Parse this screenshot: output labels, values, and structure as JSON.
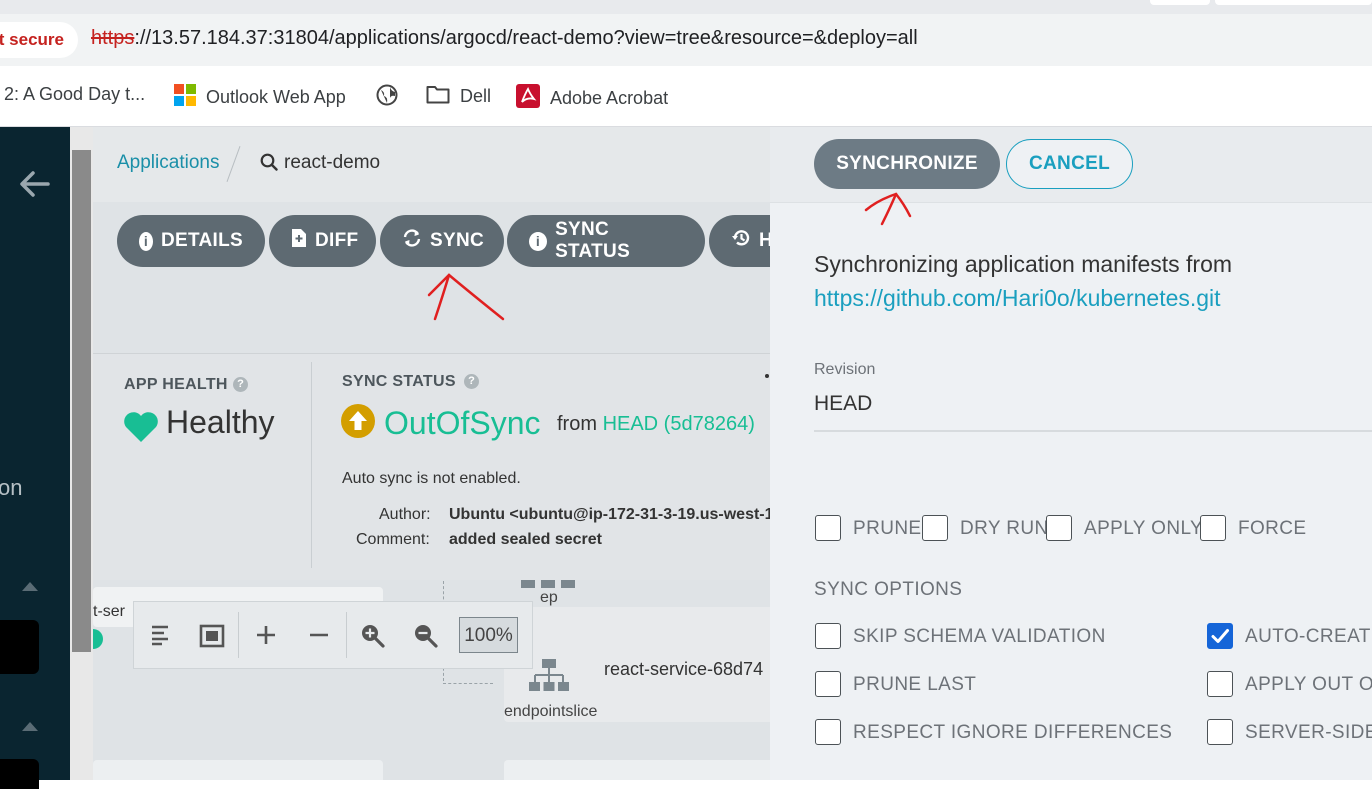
{
  "browser": {
    "security_label": "t secure",
    "url_protocol": "https",
    "url_rest": "://13.57.184.37:31804/applications/argocd/react-demo?view=tree&resource=&deploy=all",
    "bookmarks": [
      {
        "label": "2: A Good Day t...",
        "icon": "page-icon"
      },
      {
        "label": "Outlook Web App",
        "icon": "microsoft-logo-icon"
      },
      {
        "label": "",
        "icon": "globe-icon"
      },
      {
        "label": "Dell",
        "icon": "folder-icon"
      },
      {
        "label": "Adobe Acrobat",
        "icon": "acrobat-icon"
      }
    ]
  },
  "sidebar": {
    "partial_text": "on",
    "colors": {
      "bg": "#0a2530"
    }
  },
  "app": {
    "breadcrumb_root": "Applications",
    "breadcrumb_current": "react-demo",
    "toolbar": [
      {
        "label": "DETAILS",
        "icon": "info-icon"
      },
      {
        "label": "DIFF",
        "icon": "file-diff-icon"
      },
      {
        "label": "SYNC",
        "icon": "sync-icon"
      },
      {
        "label": "SYNC STATUS",
        "icon": "info-icon"
      },
      {
        "label": "H",
        "icon": "history-icon"
      }
    ],
    "health": {
      "heading": "APP HEALTH",
      "value": "Healthy",
      "color": "#18be94"
    },
    "sync_status": {
      "heading": "SYNC STATUS",
      "value": "OutOfSync",
      "from_label": "from",
      "revision": "HEAD (5d78264)",
      "auto_sync": "Auto sync is not enabled.",
      "author_label": "Author:",
      "author_value": "Ubuntu <ubuntu@ip-172-31-3-19.us-west-1",
      "comment_label": "Comment:",
      "comment_value": "added sealed secret",
      "color": "#18be94"
    },
    "tree": {
      "node_partial": "ct-ser",
      "ep_label": "ep",
      "endpointslice_label": "endpointslice",
      "service_name": "react-service-68d74"
    },
    "zoom": {
      "value": "100%"
    }
  },
  "sync_panel": {
    "synchronize_label": "SYNCHRONIZE",
    "cancel_label": "CANCEL",
    "intro_text": "Synchronizing application manifests from",
    "repo_url": "https://github.com/Hari0o/kubernetes.git",
    "revision_label": "Revision",
    "revision_value": "HEAD",
    "options_top": [
      {
        "label": "PRUNE",
        "checked": false
      },
      {
        "label": "DRY RUN",
        "checked": false
      },
      {
        "label": "APPLY ONLY",
        "checked": false
      },
      {
        "label": "FORCE",
        "checked": false
      }
    ],
    "sync_options_heading": "SYNC OPTIONS",
    "sync_options_left": [
      {
        "label": "SKIP SCHEMA VALIDATION",
        "checked": false
      },
      {
        "label": "PRUNE LAST",
        "checked": false
      },
      {
        "label": "RESPECT IGNORE DIFFERENCES",
        "checked": false
      }
    ],
    "sync_options_right": [
      {
        "label": "AUTO-CREATE",
        "checked": true
      },
      {
        "label": "APPLY OUT OF",
        "checked": false
      },
      {
        "label": "SERVER-SIDE A",
        "checked": false
      }
    ],
    "colors": {
      "accent": "#1a9fbf",
      "check": "#1565d8",
      "button": "#6d7b85"
    }
  }
}
